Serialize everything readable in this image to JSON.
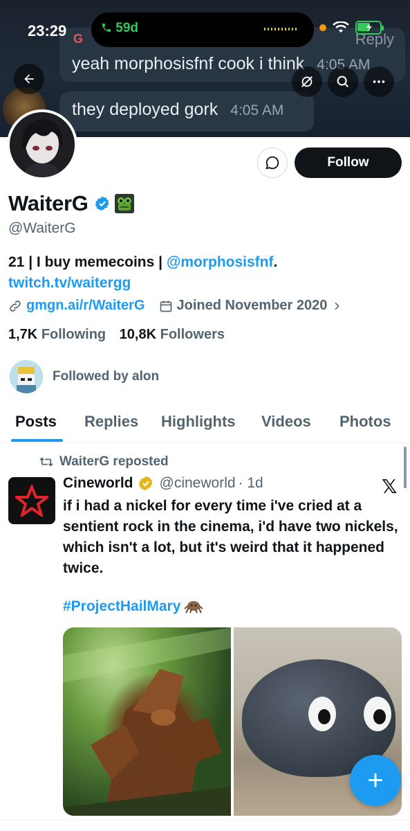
{
  "status_bar": {
    "time": "23:29",
    "call_duration": "59d"
  },
  "banner": {
    "gtag": "G",
    "reply_label": "Reply",
    "message1": "yeah morphosisfnf cook i think",
    "message1_time": "4:05 AM",
    "message2": "they deployed gork",
    "message2_time": "4:05 AM"
  },
  "profile": {
    "display_name": "WaiterG",
    "handle": "@WaiterG",
    "bio_prefix": "21 | I buy memecoins | ",
    "bio_mention": "@morphosisfnf",
    "bio_dot": ".",
    "bio_link": "twitch.tv/waitergg",
    "website": "gmgn.ai/r/WaiterG",
    "joined": "Joined November 2020",
    "following_count": "1,7K",
    "following_label": "Following",
    "followers_count": "10,8K",
    "followers_label": "Followers",
    "followed_by": "Followed by alon",
    "follow_button": "Follow"
  },
  "tabs": [
    {
      "label": "Posts",
      "active": true
    },
    {
      "label": "Replies"
    },
    {
      "label": "Highlights"
    },
    {
      "label": "Videos"
    },
    {
      "label": "Photos"
    }
  ],
  "post": {
    "repost_label": "WaiterG reposted",
    "author_name": "Cineworld",
    "author_handle": "@cineworld",
    "time": "· 1d",
    "text": "if i had a nickel for every time i've cried at a sentient rock in the cinema, i'd have two nickels, which isn't a lot, but it's weird that it happened twice.",
    "hashtag": "#ProjectHailMary"
  },
  "colors": {
    "accent": "#1d9bf0",
    "text": "#0f1419",
    "muted": "#536471",
    "follow_bg": "#0f1419",
    "verified_blue": "#1d9bf0",
    "verified_gold": "#e2b719"
  },
  "icons": {
    "back": "arrow-left-icon",
    "grok": "grok-icon",
    "search": "search-icon",
    "more": "more-icon",
    "message": "message-icon",
    "link": "link-icon",
    "calendar": "calendar-icon",
    "repost": "repost-icon",
    "compose": "plus-icon"
  },
  "x_logo": "𝕏",
  "fab_glyph": "+"
}
